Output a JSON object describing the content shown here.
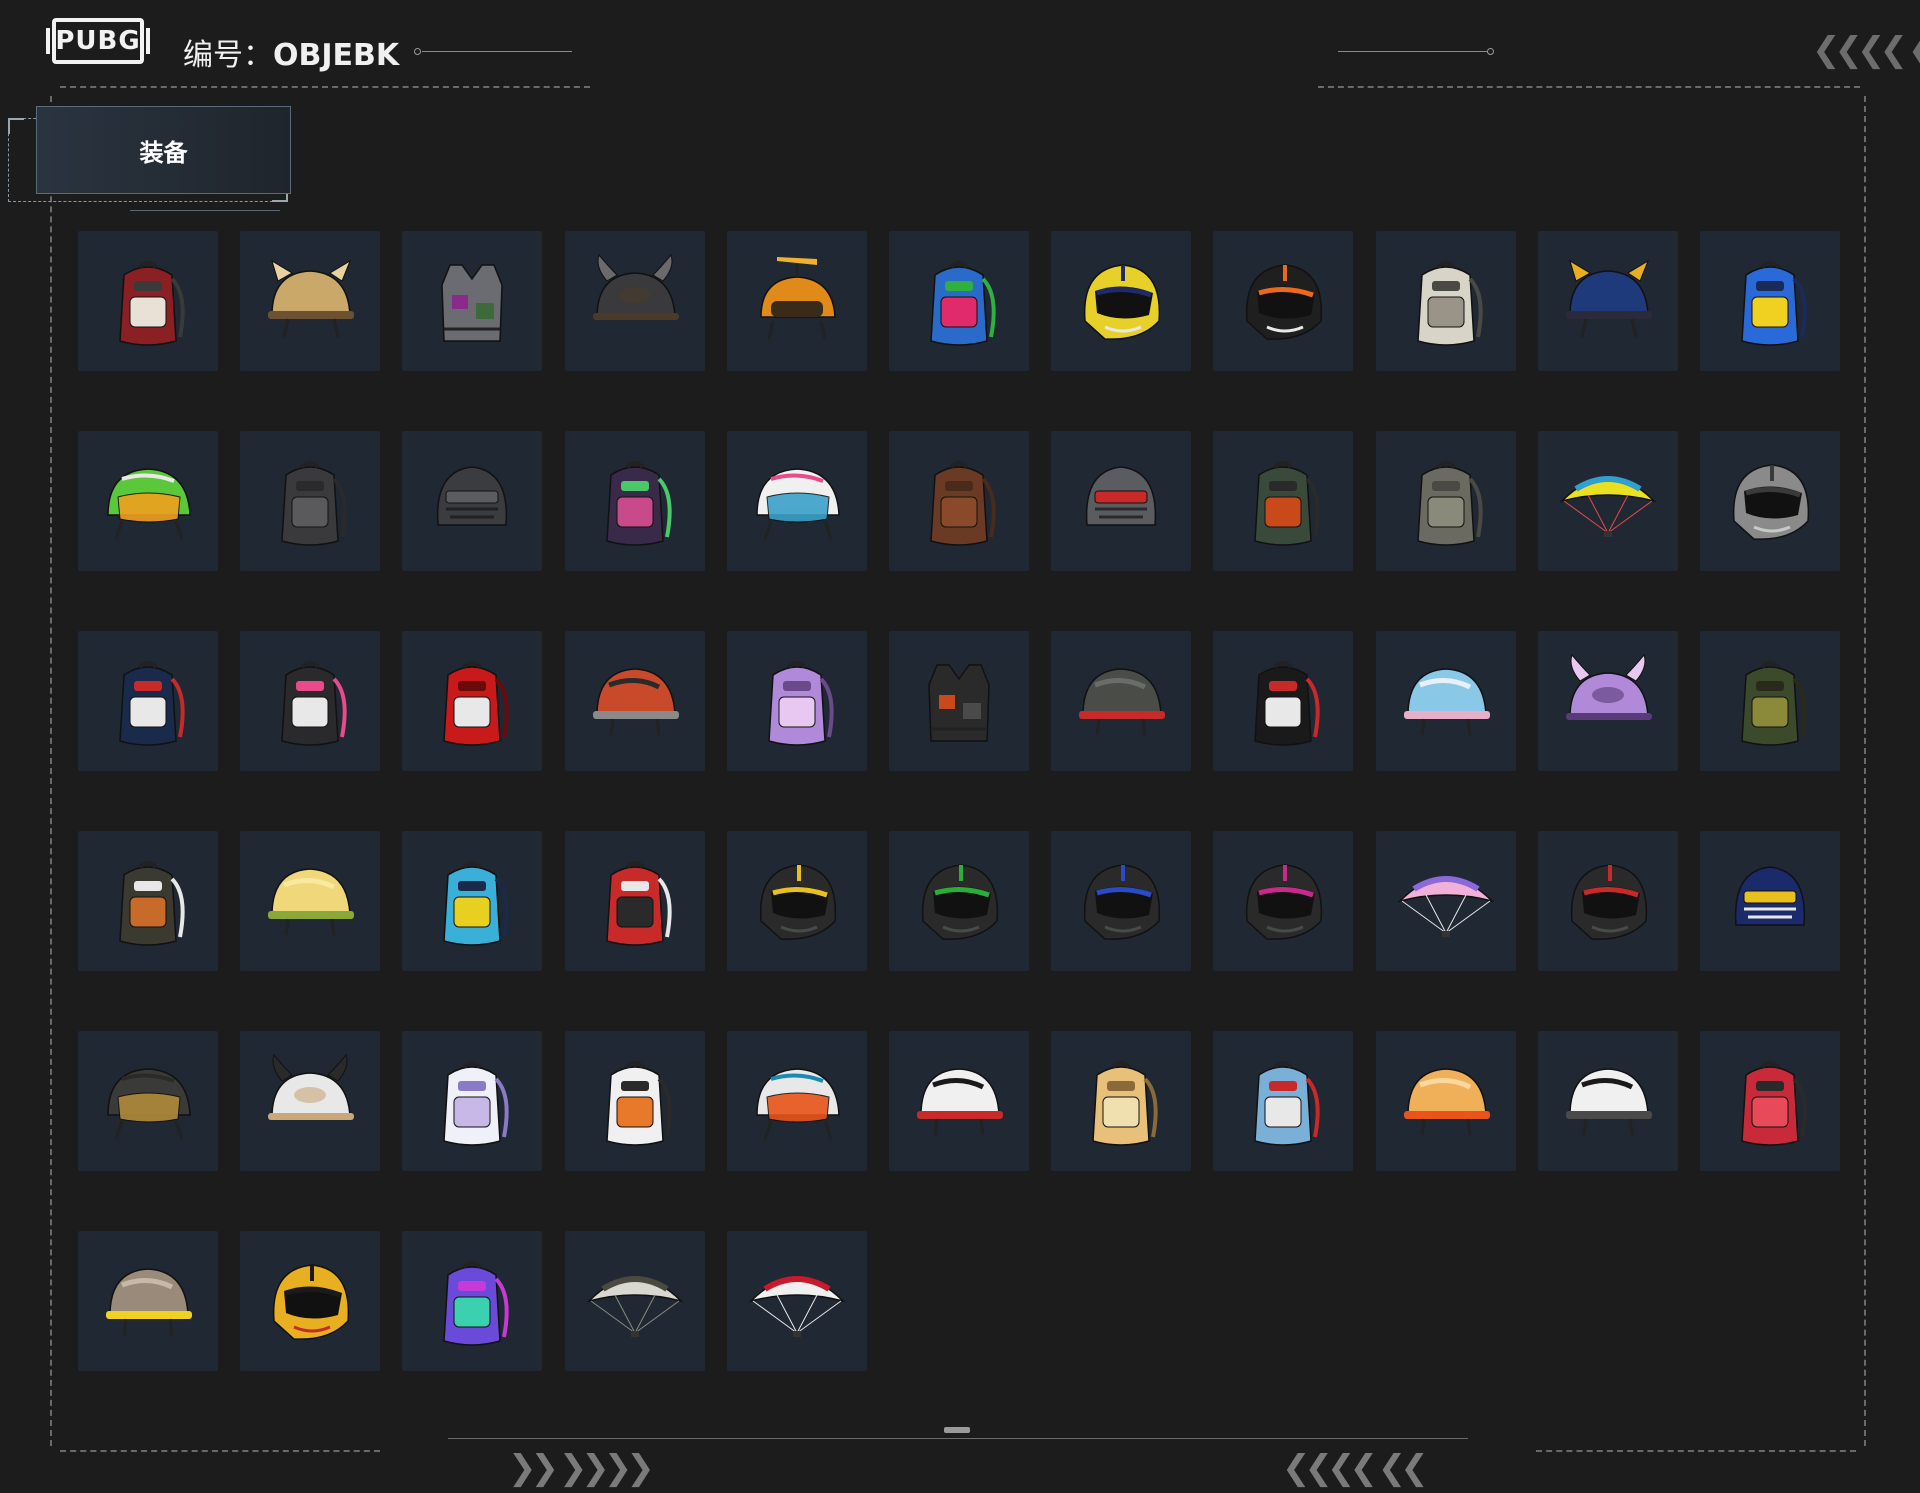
{
  "header": {
    "logo_text": "PUBG",
    "code_label": "编号：",
    "code_value": "OBJEBK"
  },
  "tab": {
    "label": "装备"
  },
  "colors": {
    "background": "#1c1c1d",
    "tile": "#1f2833",
    "dash": "#6a6a6a"
  },
  "items": [
    {
      "type": "backpack",
      "colors": [
        "#8a1f24",
        "#e8e2d6",
        "#3a3a3a"
      ]
    },
    {
      "type": "helmet-ears",
      "colors": [
        "#c9a86a",
        "#e8d2a0",
        "#6a5232"
      ]
    },
    {
      "type": "vest",
      "colors": [
        "#6a6c72",
        "#8a2a8a",
        "#3c6a3a"
      ]
    },
    {
      "type": "helmet-horns",
      "colors": [
        "#3a3a3c",
        "#6a6a6c",
        "#4a3a2a"
      ]
    },
    {
      "type": "helmet-propeller",
      "colors": [
        "#e08a1a",
        "#f0b030",
        "#3a2a1a"
      ]
    },
    {
      "type": "backpack",
      "colors": [
        "#2a6ac8",
        "#e02a6a",
        "#30b040"
      ]
    },
    {
      "type": "moto-helmet",
      "colors": [
        "#e8d02a",
        "#1f2a6a",
        "#e8e8e8"
      ]
    },
    {
      "type": "moto-helmet",
      "colors": [
        "#1f1f1f",
        "#e86a1a",
        "#e8e8e8"
      ]
    },
    {
      "type": "backpack",
      "colors": [
        "#d8d4c8",
        "#9a9488",
        "#4a4a44"
      ]
    },
    {
      "type": "helmet-ears",
      "colors": [
        "#1f3a7a",
        "#e8b020",
        "#2a2a3a"
      ]
    },
    {
      "type": "backpack",
      "colors": [
        "#2a6ad8",
        "#f0d020",
        "#1a2a5a"
      ]
    },
    {
      "type": "helmet-visor",
      "colors": [
        "#5ac83a",
        "#f0a020",
        "#e8e8e8"
      ]
    },
    {
      "type": "backpack",
      "colors": [
        "#3a3a3c",
        "#5a5a5c",
        "#2a2a2c"
      ]
    },
    {
      "type": "helmet-mask",
      "colors": [
        "#3a3c40",
        "#5a5c60",
        "#202224"
      ]
    },
    {
      "type": "backpack",
      "colors": [
        "#3a2a4a",
        "#c84a8a",
        "#4ac86a"
      ]
    },
    {
      "type": "helmet-visor",
      "colors": [
        "#f0f0f0",
        "#3aa0c8",
        "#e84a8a"
      ]
    },
    {
      "type": "backpack",
      "colors": [
        "#6a3a24",
        "#8a4a2a",
        "#4a2a1a"
      ]
    },
    {
      "type": "helmet-mask",
      "colors": [
        "#5a5c60",
        "#c82a2a",
        "#2a2a2c"
      ]
    },
    {
      "type": "backpack",
      "colors": [
        "#3a4a3a",
        "#c84a1a",
        "#2a2a2a"
      ]
    },
    {
      "type": "backpack",
      "colors": [
        "#6a6a60",
        "#8a8a7a",
        "#4a4a44"
      ]
    },
    {
      "type": "parachute",
      "colors": [
        "#e8e020",
        "#30a0d0",
        "#e84a4a"
      ]
    },
    {
      "type": "moto-helmet",
      "colors": [
        "#8a8a8a",
        "#3a3a3a",
        "#c8c8c8"
      ]
    },
    {
      "type": "backpack",
      "colors": [
        "#1a2a4a",
        "#e8e8e8",
        "#c82a2a"
      ]
    },
    {
      "type": "backpack",
      "colors": [
        "#2a2a2c",
        "#e8e8e8",
        "#e84a8a"
      ]
    },
    {
      "type": "backpack",
      "colors": [
        "#c81a1a",
        "#e8e8e8",
        "#6a0a0a"
      ]
    },
    {
      "type": "helmet",
      "colors": [
        "#c84a2a",
        "#2a2a2a",
        "#8a8a8a"
      ]
    },
    {
      "type": "backpack",
      "colors": [
        "#b08ad8",
        "#e8c8f0",
        "#6a4a8a"
      ]
    },
    {
      "type": "vest",
      "colors": [
        "#2a2a2a",
        "#c84a1a",
        "#4a4a4a"
      ]
    },
    {
      "type": "helmet",
      "colors": [
        "#4a4c48",
        "#6a6c68",
        "#c82a2a"
      ]
    },
    {
      "type": "backpack",
      "colors": [
        "#1a1a1a",
        "#e8e8e8",
        "#c82a2a"
      ]
    },
    {
      "type": "helmet",
      "colors": [
        "#8ac8e8",
        "#e8f0f8",
        "#e8b0c8"
      ]
    },
    {
      "type": "helmet-horns",
      "colors": [
        "#b08ad8",
        "#e8c8f0",
        "#5a3a7a"
      ]
    },
    {
      "type": "backpack",
      "colors": [
        "#3a4a2a",
        "#8a8a3a",
        "#2a2a1a"
      ]
    },
    {
      "type": "backpack",
      "colors": [
        "#3a3a30",
        "#c86a2a",
        "#e8e8e8"
      ]
    },
    {
      "type": "helmet",
      "colors": [
        "#f0d87a",
        "#f8e8a0",
        "#8aa83a"
      ]
    },
    {
      "type": "backpack",
      "colors": [
        "#3ab0d8",
        "#e8d020",
        "#1a2a4a"
      ]
    },
    {
      "type": "backpack",
      "colors": [
        "#c82a2a",
        "#2a2a2a",
        "#e8e8e8"
      ]
    },
    {
      "type": "moto-helmet",
      "colors": [
        "#2a2a2a",
        "#e8c020",
        "#4a4a4a"
      ]
    },
    {
      "type": "moto-helmet",
      "colors": [
        "#2a2a2a",
        "#2ab03a",
        "#4a4a4a"
      ]
    },
    {
      "type": "moto-helmet",
      "colors": [
        "#2a2a2a",
        "#2a4ac8",
        "#4a4a4a"
      ]
    },
    {
      "type": "moto-helmet",
      "colors": [
        "#2a2a2a",
        "#c82a8a",
        "#4a4a4a"
      ]
    },
    {
      "type": "parachute",
      "colors": [
        "#f0b0d8",
        "#8a6ad8",
        "#e8e8e8"
      ]
    },
    {
      "type": "moto-helmet",
      "colors": [
        "#2a2a2a",
        "#c82a2a",
        "#4a4a4a"
      ]
    },
    {
      "type": "helmet-mask",
      "colors": [
        "#1a2a6a",
        "#e8c020",
        "#e8e8e8"
      ]
    },
    {
      "type": "helmet-visor",
      "colors": [
        "#3a3a38",
        "#b08a3a",
        "#2a2a28"
      ]
    },
    {
      "type": "helmet-horns",
      "colors": [
        "#e8e8e8",
        "#2a2a2a",
        "#c8a87a"
      ]
    },
    {
      "type": "backpack",
      "colors": [
        "#f0f0f8",
        "#c8b8e8",
        "#8a7ac8"
      ]
    },
    {
      "type": "backpack",
      "colors": [
        "#f0f0f0",
        "#e8782a",
        "#2a2a2a"
      ]
    },
    {
      "type": "helmet-visor",
      "colors": [
        "#e8e8e8",
        "#e8541a",
        "#1a8ab0"
      ]
    },
    {
      "type": "helmet",
      "colors": [
        "#f0f0f0",
        "#1a1a1a",
        "#c82a2a"
      ]
    },
    {
      "type": "backpack",
      "colors": [
        "#e8c07a",
        "#f0e0b0",
        "#8a6a3a"
      ]
    },
    {
      "type": "backpack",
      "colors": [
        "#7ab0d8",
        "#e8e8e8",
        "#c82a2a"
      ]
    },
    {
      "type": "helmet",
      "colors": [
        "#f0b05a",
        "#f8d8a0",
        "#e8541a"
      ]
    },
    {
      "type": "helmet",
      "colors": [
        "#f0f0f0",
        "#1a1a1a",
        "#4a4a4a"
      ]
    },
    {
      "type": "backpack",
      "colors": [
        "#c82a3a",
        "#e84a5a",
        "#2a2a2a"
      ]
    },
    {
      "type": "helmet",
      "colors": [
        "#9a8a7a",
        "#c8b8a8",
        "#f0d020"
      ]
    },
    {
      "type": "moto-helmet",
      "colors": [
        "#e8b020",
        "#1a1a1a",
        "#c82a2a"
      ]
    },
    {
      "type": "backpack",
      "colors": [
        "#6a4ad8",
        "#3ad0b0",
        "#c83ad8"
      ]
    },
    {
      "type": "parachute",
      "colors": [
        "#d8d8d0",
        "#4a4a40",
        "#8a8a80"
      ]
    },
    {
      "type": "parachute",
      "colors": [
        "#f0f0f0",
        "#c81a2a",
        "#e8e8e8"
      ]
    }
  ],
  "footer": {
    "left_chevrons": "❯❯ ❯❯❯❯",
    "right_chevrons": "❮❮❮❮ ❮❮",
    "top_right_chevrons": "❮❮❮❮ ❮"
  }
}
